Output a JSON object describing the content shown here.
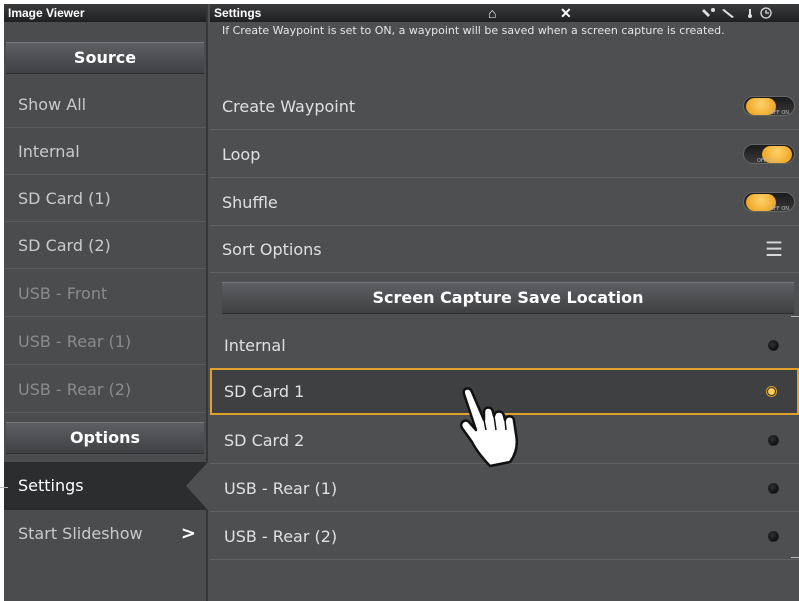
{
  "left": {
    "title": "Image Viewer",
    "source_header": "Source",
    "source_items": [
      {
        "label": "Show All"
      },
      {
        "label": "Internal"
      },
      {
        "label": "SD Card (1)"
      },
      {
        "label": "SD Card (2)"
      },
      {
        "label": "USB - Front"
      },
      {
        "label": "USB - Rear (1)"
      },
      {
        "label": "USB - Rear (2)"
      }
    ],
    "options_header": "Options",
    "options_items": [
      {
        "label": "Settings"
      },
      {
        "label": "Start Slideshow",
        "chevron": ">"
      }
    ]
  },
  "right": {
    "title": "Settings",
    "info": "If Create Waypoint is set to ON, a waypoint will be saved when a screen capture is created.",
    "settings": [
      {
        "label": "Create Waypoint",
        "control": "toggle",
        "state": "OFF",
        "toggle_text": "OFF ON"
      },
      {
        "label": "Loop",
        "control": "toggle",
        "state": "ON",
        "toggle_text": "OFF ON"
      },
      {
        "label": "Shuffle",
        "control": "toggle",
        "state": "OFF",
        "toggle_text": "OFF ON"
      },
      {
        "label": "Sort Options",
        "control": "menu",
        "icon": "menu-icon"
      }
    ],
    "capture_header": "Screen Capture Save Location",
    "locations": [
      {
        "label": "Internal",
        "selected": false
      },
      {
        "label": "SD Card 1",
        "selected": true
      },
      {
        "label": "SD Card 2",
        "selected": false
      },
      {
        "label": "USB - Rear (1)",
        "selected": false
      },
      {
        "label": "USB - Rear (2)",
        "selected": false
      }
    ]
  },
  "topbar": {
    "icons": [
      "home-icon",
      "close-icon",
      "gps-icon",
      "satellite-icon",
      "thermometer-icon",
      "clock-icon"
    ],
    "close_glyph": "✕",
    "home_glyph": "⌂"
  },
  "colors": {
    "accent": "#e0a22a",
    "panel": "#4e4f51",
    "selected_bg": "#2c2d2f"
  }
}
